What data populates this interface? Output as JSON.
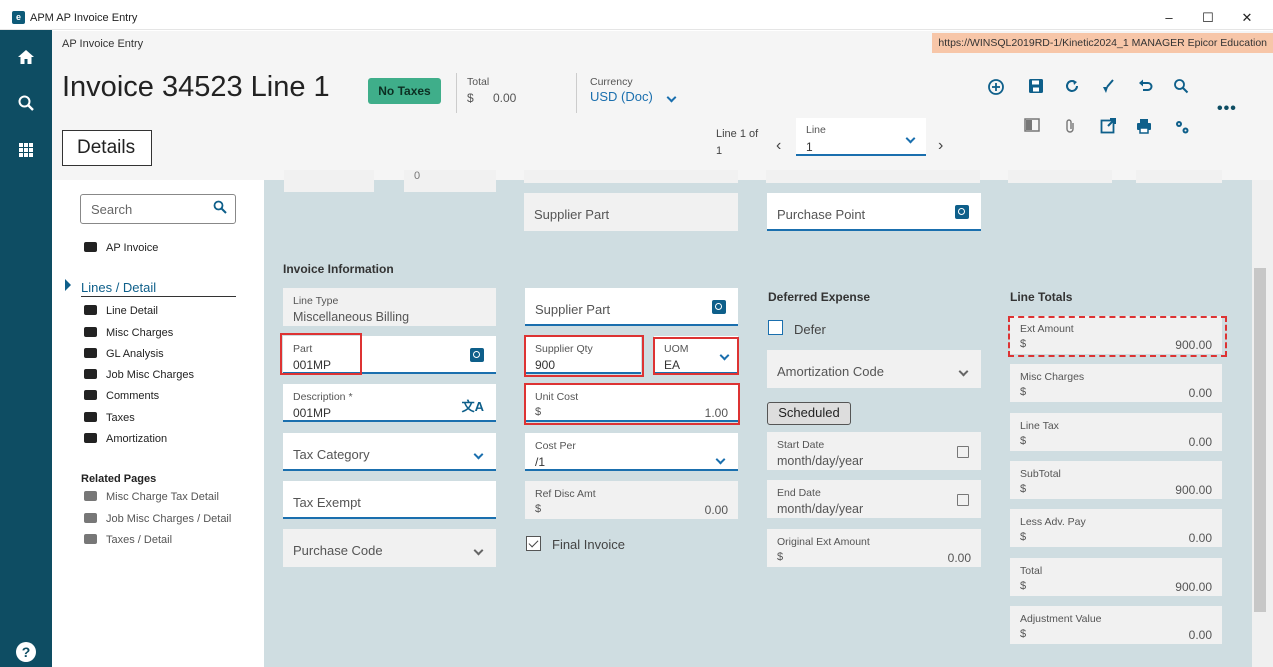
{
  "window": {
    "title": "APM AP Invoice Entry",
    "minimize": "–",
    "maximize": "☐",
    "close": "✕"
  },
  "header": {
    "breadcrumb": "AP Invoice Entry",
    "connection": "https://WINSQL2019RD-1/Kinetic2024_1   MANAGER   Epicor Education",
    "title": "Invoice 34523 Line 1",
    "badge": "No Taxes",
    "total_label": "Total",
    "total_currency": "$",
    "total_value": "0.00",
    "currency_label": "Currency",
    "currency_value": "USD (Doc)",
    "details_label": "Details",
    "line_of": "Line 1 of",
    "line_count": "1",
    "line_label": "Line",
    "line_value": "1"
  },
  "toolbar": {
    "icons": [
      "add-icon",
      "save-icon",
      "refresh-icon",
      "clear-icon",
      "undo-icon",
      "search-icon",
      "panel-icon",
      "attachment-icon",
      "open-icon",
      "print-icon",
      "settings-icon"
    ],
    "more": "•••"
  },
  "nav": {
    "search_placeholder": "Search",
    "ap_invoice": "AP Invoice",
    "section": "Lines / Detail",
    "items": [
      "Line Detail",
      "Misc Charges",
      "GL Analysis",
      "Job Misc Charges",
      "Comments",
      "Taxes",
      "Amortization"
    ],
    "related_heading": "Related Pages",
    "related": [
      "Misc Charge Tax Detail",
      "Job Misc Charges / Detail",
      "Taxes / Detail"
    ]
  },
  "top_partial": {
    "field_value": "0"
  },
  "col2_top": {
    "supplier_part": "Supplier Part"
  },
  "col3_top": {
    "purchase_point": "Purchase Point"
  },
  "invoice_info": {
    "heading": "Invoice Information",
    "line_type_label": "Line Type",
    "line_type_value": "Miscellaneous Billing",
    "part_label": "Part",
    "part_value": "001MP",
    "description_label": "Description *",
    "description_value": "001MP",
    "tax_category": "Tax Category",
    "tax_exempt": "Tax Exempt",
    "purchase_code": "Purchase Code"
  },
  "supplier": {
    "supplier_part": "Supplier Part",
    "supplier_qty_label": "Supplier Qty",
    "supplier_qty_value": "900",
    "uom_label": "UOM",
    "uom_value": "EA",
    "unit_cost_label": "Unit Cost",
    "unit_cost_currency": "$",
    "unit_cost_value": "1.00",
    "cost_per_label": "Cost Per",
    "cost_per_value": "/1",
    "ref_disc_label": "Ref Disc Amt",
    "ref_disc_currency": "$",
    "ref_disc_value": "0.00",
    "final_invoice": "Final Invoice"
  },
  "deferred": {
    "heading": "Deferred Expense",
    "defer": "Defer",
    "amortization_code": "Amortization Code",
    "scheduled": "Scheduled",
    "start_date_label": "Start Date",
    "start_date_placeholder": "month/day/year",
    "end_date_label": "End Date",
    "end_date_placeholder": "month/day/year",
    "orig_ext_label": "Original Ext Amount",
    "orig_ext_currency": "$",
    "orig_ext_value": "0.00"
  },
  "line_totals": {
    "heading": "Line Totals",
    "rows": [
      {
        "label": "Ext Amount",
        "currency": "$",
        "value": "900.00"
      },
      {
        "label": "Misc Charges",
        "currency": "$",
        "value": "0.00"
      },
      {
        "label": "Line Tax",
        "currency": "$",
        "value": "0.00"
      },
      {
        "label": "SubTotal",
        "currency": "$",
        "value": "900.00"
      },
      {
        "label": "Less Adv. Pay",
        "currency": "$",
        "value": "0.00"
      },
      {
        "label": "Total",
        "currency": "$",
        "value": "900.00"
      },
      {
        "label": "Adjustment Value",
        "currency": "$",
        "value": "0.00"
      }
    ]
  },
  "colors": {
    "rail": "#0e4d63",
    "accent": "#1a6fae",
    "badge": "#3fae8a",
    "highlight": "#dd3333",
    "content_bg": "#cfdde1"
  }
}
